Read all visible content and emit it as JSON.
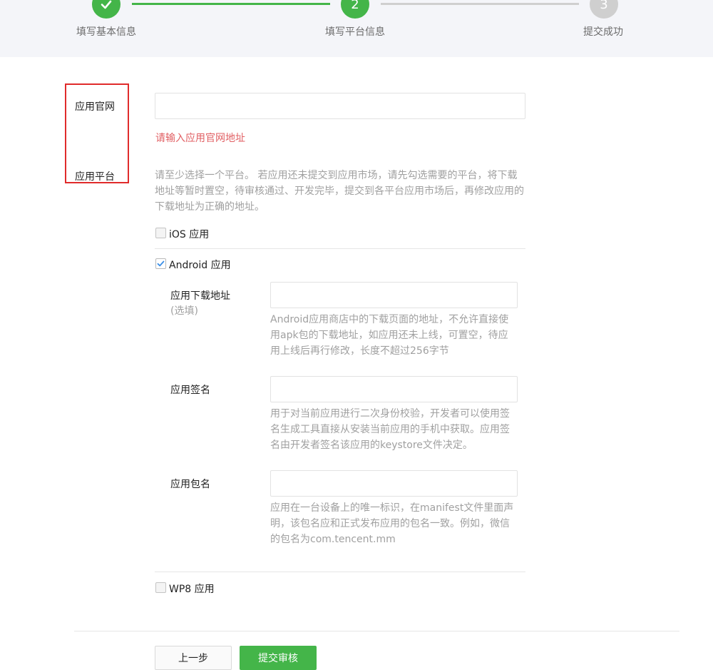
{
  "stepper": {
    "steps": [
      {
        "number": "✓",
        "label": "填写基本信息",
        "state": "done"
      },
      {
        "number": "2",
        "label": "填写平台信息",
        "state": "active"
      },
      {
        "number": "3",
        "label": "提交成功",
        "state": "todo"
      }
    ]
  },
  "form": {
    "website": {
      "label": "应用官网",
      "value": "",
      "error": "请输入应用官网地址"
    },
    "platform": {
      "label": "应用平台",
      "description": "请至少选择一个平台。 若应用还未提交到应用市场，请先勾选需要的平台，将下载地址等暂时置空，待审核通过、开发完毕，提交到各平台应用市场后，再修改应用的下载地址为正确的地址。",
      "ios": {
        "label": "iOS 应用",
        "checked": false
      },
      "android": {
        "label": "Android 应用",
        "checked": true,
        "download": {
          "label": "应用下载地址",
          "sublabel": "(选填)",
          "value": "",
          "hint": "Android应用商店中的下载页面的地址，不允许直接使用apk包的下载地址，如应用还未上线，可置空，待应用上线后再行修改，长度不超过256字节"
        },
        "signature": {
          "label": "应用签名",
          "value": "",
          "hint": "用于对当前应用进行二次身份校验，开发者可以使用签名生成工具直接从安装当前应用的手机中获取。应用签名由开发者签名该应用的keystore文件决定。"
        },
        "package": {
          "label": "应用包名",
          "value": "",
          "hint": "应用在一台设备上的唯一标识，在manifest文件里面声明，该包名应和正式发布应用的包名一致。例如，微信的包名为com.tencent.mm"
        }
      },
      "wp8": {
        "label": "WP8 应用",
        "checked": false
      }
    }
  },
  "actions": {
    "prev_label": "上一步",
    "submit_label": "提交审核"
  },
  "colors": {
    "brand_green": "#44b549",
    "error_red": "#e15f63",
    "highlight_red": "#e02b2b",
    "inactive_gray": "#cfcfcf"
  }
}
